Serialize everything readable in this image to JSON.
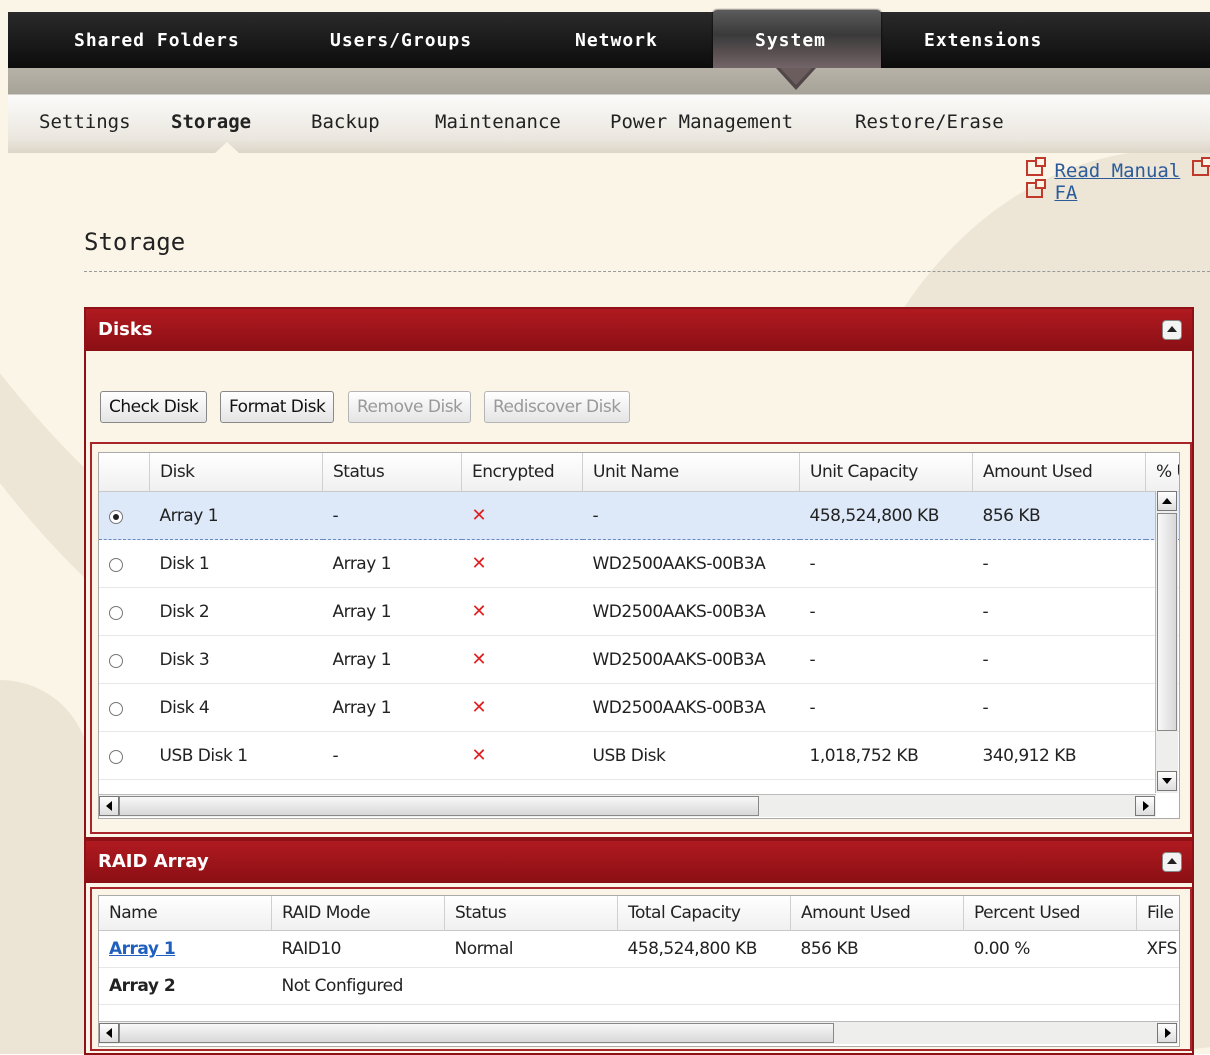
{
  "top_nav": {
    "tabs": [
      "Shared Folders",
      "Users/Groups",
      "Network",
      "System",
      "Extensions"
    ],
    "active": "System"
  },
  "sub_nav": {
    "items": [
      "Settings",
      "Storage",
      "Backup",
      "Maintenance",
      "Power Management",
      "Restore/Erase"
    ],
    "active": "Storage"
  },
  "help_links": {
    "read_manual": "Read Manual",
    "faq": "FA"
  },
  "page_title": "Storage",
  "disks_panel": {
    "title": "Disks",
    "buttons": {
      "check_disk": "Check Disk",
      "format_disk": "Format Disk",
      "remove_disk": "Remove Disk",
      "rediscover_disk": "Rediscover Disk"
    },
    "columns": [
      "Disk",
      "Status",
      "Encrypted",
      "Unit Name",
      "Unit Capacity",
      "Amount Used",
      "% U"
    ],
    "rows": [
      {
        "disk": "Array 1",
        "status": "-",
        "encrypted": "✕",
        "unit_name": "-",
        "unit_capacity": "458,524,800 KB",
        "amount_used": "856 KB",
        "selected": true
      },
      {
        "disk": "Disk 1",
        "status": "Array 1",
        "encrypted": "✕",
        "unit_name": "WD2500AAKS-00B3A",
        "unit_capacity": "-",
        "amount_used": "-",
        "selected": false
      },
      {
        "disk": "Disk 2",
        "status": "Array 1",
        "encrypted": "✕",
        "unit_name": "WD2500AAKS-00B3A",
        "unit_capacity": "-",
        "amount_used": "-",
        "selected": false
      },
      {
        "disk": "Disk 3",
        "status": "Array 1",
        "encrypted": "✕",
        "unit_name": "WD2500AAKS-00B3A",
        "unit_capacity": "-",
        "amount_used": "-",
        "selected": false
      },
      {
        "disk": "Disk 4",
        "status": "Array 1",
        "encrypted": "✕",
        "unit_name": "WD2500AAKS-00B3A",
        "unit_capacity": "-",
        "amount_used": "-",
        "selected": false
      },
      {
        "disk": "USB Disk 1",
        "status": "-",
        "encrypted": "✕",
        "unit_name": "USB Disk",
        "unit_capacity": "1,018,752 KB",
        "amount_used": "340,912 KB",
        "selected": false
      }
    ]
  },
  "raid_panel": {
    "title": "RAID Array",
    "columns": [
      "Name",
      "RAID Mode",
      "Status",
      "Total Capacity",
      "Amount Used",
      "Percent Used",
      "File"
    ],
    "rows": [
      {
        "name": "Array 1",
        "raid_mode": "RAID10",
        "status": "Normal",
        "total_capacity": "458,524,800 KB",
        "amount_used": "856 KB",
        "percent_used": "0.00 %",
        "file": "XFS"
      },
      {
        "name": "Array 2",
        "raid_mode": "Not Configured",
        "status": "",
        "total_capacity": "",
        "amount_used": "",
        "percent_used": "",
        "file": ""
      }
    ]
  },
  "colors": {
    "panel_header": "#8a0f14",
    "nav_bg": "#111111",
    "link": "#1f5fbf",
    "error_x": "#e0201f"
  }
}
